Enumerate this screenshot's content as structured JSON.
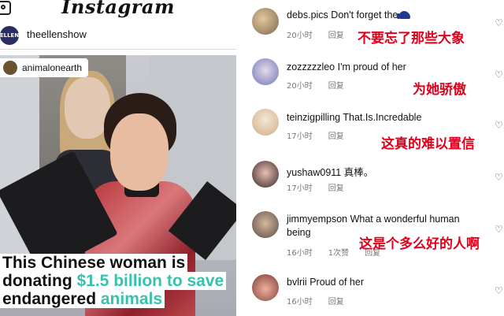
{
  "post": {
    "app_title": "Instagram",
    "account": {
      "name": "theellenshow",
      "avatar_text": "ELLEN"
    },
    "tagged_account": "animalonearth",
    "caption": {
      "line1": "This Chinese woman is",
      "line2_prefix": "donating ",
      "line2_highlight": "$1.5 billion to save",
      "line3_prefix": "endangered ",
      "line3_highlight": "animals"
    },
    "highlight_color": "#38c2ae"
  },
  "comments": [
    {
      "user": "debs.pics",
      "text": "Don't forget the",
      "emoji": "elephant-emoji",
      "time": "20小时",
      "reply": "回复",
      "likes": "",
      "translation": "不要忘了那些大象"
    },
    {
      "user": "zozzzzzleo",
      "text": "I'm proud of her",
      "time": "20小时",
      "reply": "回复",
      "likes": "",
      "translation": "为她骄傲"
    },
    {
      "user": "teinzigpilling",
      "text": "That.Is.Incredable",
      "time": "17小时",
      "reply": "回复",
      "likes": "",
      "translation": "这真的难以置信"
    },
    {
      "user": "yushaw0911",
      "text": "真棒。",
      "time": "17小时",
      "reply": "回复",
      "likes": "",
      "translation": ""
    },
    {
      "user": "jimmyempson",
      "text": "What a wonderful human",
      "text2": "being",
      "time": "16小时",
      "reply": "回复",
      "likes": "1次赞",
      "translation": "这是个多么好的人啊"
    },
    {
      "user": "bvlrii",
      "text": "Proud of her",
      "time": "16小时",
      "reply": "回复",
      "likes": "",
      "translation": ""
    }
  ],
  "translation_color": "#e0001b"
}
